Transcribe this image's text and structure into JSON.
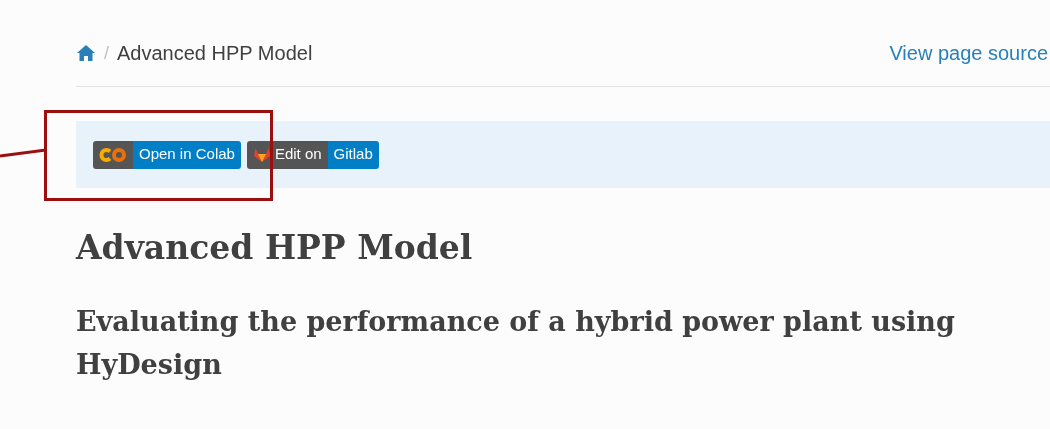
{
  "breadcrumb": {
    "separator": "/",
    "current": "Advanced HPP Model"
  },
  "page_source_link": "View page source",
  "badges": [
    {
      "kind": "colab",
      "right": "Open in Colab"
    },
    {
      "kind": "gitlab",
      "left": "Edit on",
      "right": "Gitlab"
    }
  ],
  "title": "Advanced HPP Model",
  "subtitle": "Evaluating the performance of a hybrid power plant using HyDesign"
}
